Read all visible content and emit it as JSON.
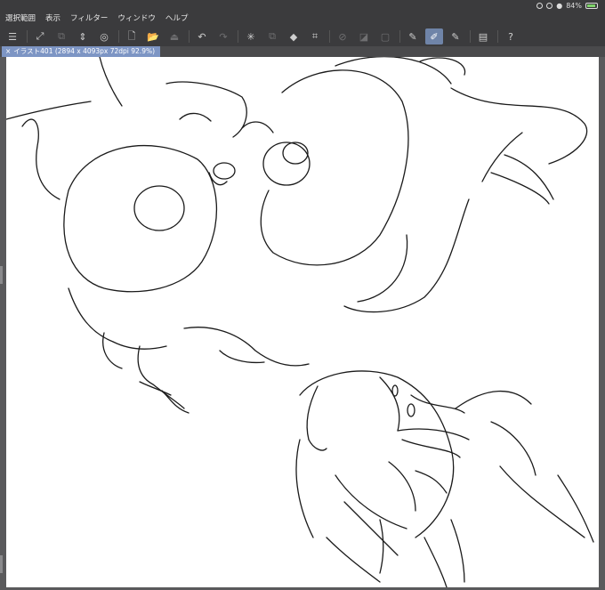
{
  "menu": {
    "items": [
      "選択範囲",
      "表示",
      "フィルター",
      "ウィンドウ",
      "ヘルプ"
    ]
  },
  "status": {
    "battery_percent": "84%"
  },
  "toolbar": {
    "buttons": [
      {
        "name": "menu-icon",
        "glyph": "☰"
      },
      {
        "name": "expand-canvas-icon",
        "glyph": "⤢"
      },
      {
        "name": "layer-property-icon",
        "glyph": "⧉"
      },
      {
        "name": "arrow-updown-icon",
        "glyph": "⇕"
      },
      {
        "name": "color-icon",
        "glyph": "◎"
      },
      {
        "name": "new-file-icon",
        "glyph": "🗋"
      },
      {
        "name": "open-folder-icon",
        "glyph": "📂"
      },
      {
        "name": "save-icon",
        "glyph": "⏏"
      },
      {
        "name": "undo-icon",
        "glyph": "↶"
      },
      {
        "name": "redo-icon",
        "glyph": "↷"
      },
      {
        "name": "loading-icon",
        "glyph": "✳"
      },
      {
        "name": "copy-icon",
        "glyph": "⧉"
      },
      {
        "name": "fill-icon",
        "glyph": "◆"
      },
      {
        "name": "transform-icon",
        "glyph": "⌗"
      },
      {
        "name": "select-off-icon",
        "glyph": "⊘"
      },
      {
        "name": "layer-mask-icon",
        "glyph": "◪"
      },
      {
        "name": "select-all-icon",
        "glyph": "▢"
      },
      {
        "name": "pen-tool-icon",
        "glyph": "✎"
      },
      {
        "name": "brush-tool-icon",
        "glyph": "✐"
      },
      {
        "name": "eraser-tool-icon",
        "glyph": "✎"
      },
      {
        "name": "device-icon",
        "glyph": "▤"
      },
      {
        "name": "help-icon",
        "glyph": "?"
      }
    ]
  },
  "document": {
    "tab_label": "イラスト401 (2894 x 4093px 72dpi 92.9%)",
    "close_glyph": "×"
  }
}
